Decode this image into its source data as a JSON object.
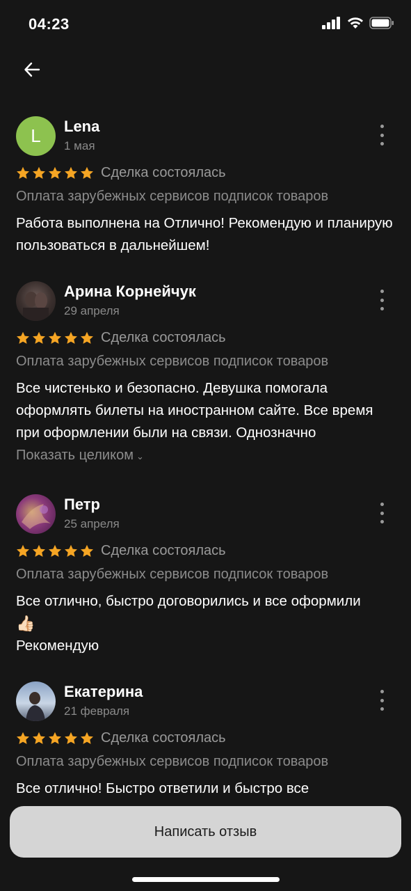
{
  "status_bar": {
    "time": "04:23"
  },
  "nav": {
    "back_icon": "arrow-left-icon"
  },
  "reviews": [
    {
      "name": "Lena",
      "avatar_letter": "L",
      "avatar_color": "#8dc24f",
      "date": "1 мая",
      "rating": 5,
      "deal_status": "Сделка состоялась",
      "service": "Оплата зарубежных сервисов подписок товаров",
      "text": "Работа выполнена на Отлично! Рекомендую и планирую пользоваться в дальнейшем!"
    },
    {
      "name": "Арина Корнейчук",
      "date": "29 апреля",
      "rating": 5,
      "deal_status": "Сделка состоялась",
      "service": "Оплата зарубежных сервисов подписок товаров",
      "text": "Все чистенько и безопасно. Девушка помогала оформлять билеты на иностранном сайте. Все время при оформлении были на связи. Однозначно",
      "show_full": "Показать целиком"
    },
    {
      "name": "Петр",
      "date": "25 апреля",
      "rating": 5,
      "deal_status": "Сделка состоялась",
      "service": "Оплата зарубежных сервисов подписок товаров",
      "text_line1": "Все отлично, быстро договорились и все оформили",
      "emoji": "👍🏻",
      "text_line3": "Рекомендую"
    },
    {
      "name": "Екатерина",
      "date": "21 февраля",
      "rating": 5,
      "deal_status": "Сделка состоялась",
      "service": "Оплата зарубежных сервисов подписок товаров",
      "text": "Все отлично! Быстро ответили и быстро все"
    }
  ],
  "write_review_button": "Написать отзыв",
  "colors": {
    "background": "#161616",
    "star": "#f5a524",
    "button_bg": "#d5d5d5",
    "muted_text": "#8c8c8c"
  }
}
